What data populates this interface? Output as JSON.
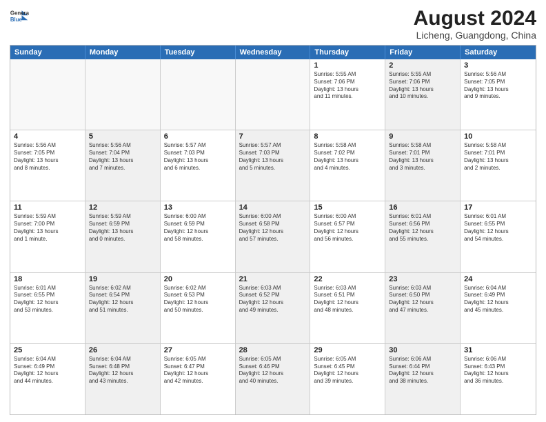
{
  "header": {
    "logo_line1": "General",
    "logo_line2": "Blue",
    "main_title": "August 2024",
    "sub_title": "Licheng, Guangdong, China"
  },
  "weekdays": [
    "Sunday",
    "Monday",
    "Tuesday",
    "Wednesday",
    "Thursday",
    "Friday",
    "Saturday"
  ],
  "rows": [
    [
      {
        "day": "",
        "info": "",
        "empty": true
      },
      {
        "day": "",
        "info": "",
        "empty": true
      },
      {
        "day": "",
        "info": "",
        "empty": true
      },
      {
        "day": "",
        "info": "",
        "empty": true
      },
      {
        "day": "1",
        "info": "Sunrise: 5:55 AM\nSunset: 7:06 PM\nDaylight: 13 hours\nand 11 minutes.",
        "empty": false
      },
      {
        "day": "2",
        "info": "Sunrise: 5:55 AM\nSunset: 7:06 PM\nDaylight: 13 hours\nand 10 minutes.",
        "empty": false,
        "shaded": true
      },
      {
        "day": "3",
        "info": "Sunrise: 5:56 AM\nSunset: 7:05 PM\nDaylight: 13 hours\nand 9 minutes.",
        "empty": false
      }
    ],
    [
      {
        "day": "4",
        "info": "Sunrise: 5:56 AM\nSunset: 7:05 PM\nDaylight: 13 hours\nand 8 minutes.",
        "empty": false
      },
      {
        "day": "5",
        "info": "Sunrise: 5:56 AM\nSunset: 7:04 PM\nDaylight: 13 hours\nand 7 minutes.",
        "empty": false,
        "shaded": true
      },
      {
        "day": "6",
        "info": "Sunrise: 5:57 AM\nSunset: 7:03 PM\nDaylight: 13 hours\nand 6 minutes.",
        "empty": false
      },
      {
        "day": "7",
        "info": "Sunrise: 5:57 AM\nSunset: 7:03 PM\nDaylight: 13 hours\nand 5 minutes.",
        "empty": false,
        "shaded": true
      },
      {
        "day": "8",
        "info": "Sunrise: 5:58 AM\nSunset: 7:02 PM\nDaylight: 13 hours\nand 4 minutes.",
        "empty": false
      },
      {
        "day": "9",
        "info": "Sunrise: 5:58 AM\nSunset: 7:01 PM\nDaylight: 13 hours\nand 3 minutes.",
        "empty": false,
        "shaded": true
      },
      {
        "day": "10",
        "info": "Sunrise: 5:58 AM\nSunset: 7:01 PM\nDaylight: 13 hours\nand 2 minutes.",
        "empty": false
      }
    ],
    [
      {
        "day": "11",
        "info": "Sunrise: 5:59 AM\nSunset: 7:00 PM\nDaylight: 13 hours\nand 1 minute.",
        "empty": false
      },
      {
        "day": "12",
        "info": "Sunrise: 5:59 AM\nSunset: 6:59 PM\nDaylight: 13 hours\nand 0 minutes.",
        "empty": false,
        "shaded": true
      },
      {
        "day": "13",
        "info": "Sunrise: 6:00 AM\nSunset: 6:59 PM\nDaylight: 12 hours\nand 58 minutes.",
        "empty": false
      },
      {
        "day": "14",
        "info": "Sunrise: 6:00 AM\nSunset: 6:58 PM\nDaylight: 12 hours\nand 57 minutes.",
        "empty": false,
        "shaded": true
      },
      {
        "day": "15",
        "info": "Sunrise: 6:00 AM\nSunset: 6:57 PM\nDaylight: 12 hours\nand 56 minutes.",
        "empty": false
      },
      {
        "day": "16",
        "info": "Sunrise: 6:01 AM\nSunset: 6:56 PM\nDaylight: 12 hours\nand 55 minutes.",
        "empty": false,
        "shaded": true
      },
      {
        "day": "17",
        "info": "Sunrise: 6:01 AM\nSunset: 6:55 PM\nDaylight: 12 hours\nand 54 minutes.",
        "empty": false
      }
    ],
    [
      {
        "day": "18",
        "info": "Sunrise: 6:01 AM\nSunset: 6:55 PM\nDaylight: 12 hours\nand 53 minutes.",
        "empty": false
      },
      {
        "day": "19",
        "info": "Sunrise: 6:02 AM\nSunset: 6:54 PM\nDaylight: 12 hours\nand 51 minutes.",
        "empty": false,
        "shaded": true
      },
      {
        "day": "20",
        "info": "Sunrise: 6:02 AM\nSunset: 6:53 PM\nDaylight: 12 hours\nand 50 minutes.",
        "empty": false
      },
      {
        "day": "21",
        "info": "Sunrise: 6:03 AM\nSunset: 6:52 PM\nDaylight: 12 hours\nand 49 minutes.",
        "empty": false,
        "shaded": true
      },
      {
        "day": "22",
        "info": "Sunrise: 6:03 AM\nSunset: 6:51 PM\nDaylight: 12 hours\nand 48 minutes.",
        "empty": false
      },
      {
        "day": "23",
        "info": "Sunrise: 6:03 AM\nSunset: 6:50 PM\nDaylight: 12 hours\nand 47 minutes.",
        "empty": false,
        "shaded": true
      },
      {
        "day": "24",
        "info": "Sunrise: 6:04 AM\nSunset: 6:49 PM\nDaylight: 12 hours\nand 45 minutes.",
        "empty": false
      }
    ],
    [
      {
        "day": "25",
        "info": "Sunrise: 6:04 AM\nSunset: 6:49 PM\nDaylight: 12 hours\nand 44 minutes.",
        "empty": false
      },
      {
        "day": "26",
        "info": "Sunrise: 6:04 AM\nSunset: 6:48 PM\nDaylight: 12 hours\nand 43 minutes.",
        "empty": false,
        "shaded": true
      },
      {
        "day": "27",
        "info": "Sunrise: 6:05 AM\nSunset: 6:47 PM\nDaylight: 12 hours\nand 42 minutes.",
        "empty": false
      },
      {
        "day": "28",
        "info": "Sunrise: 6:05 AM\nSunset: 6:46 PM\nDaylight: 12 hours\nand 40 minutes.",
        "empty": false,
        "shaded": true
      },
      {
        "day": "29",
        "info": "Sunrise: 6:05 AM\nSunset: 6:45 PM\nDaylight: 12 hours\nand 39 minutes.",
        "empty": false
      },
      {
        "day": "30",
        "info": "Sunrise: 6:06 AM\nSunset: 6:44 PM\nDaylight: 12 hours\nand 38 minutes.",
        "empty": false,
        "shaded": true
      },
      {
        "day": "31",
        "info": "Sunrise: 6:06 AM\nSunset: 6:43 PM\nDaylight: 12 hours\nand 36 minutes.",
        "empty": false
      }
    ]
  ]
}
